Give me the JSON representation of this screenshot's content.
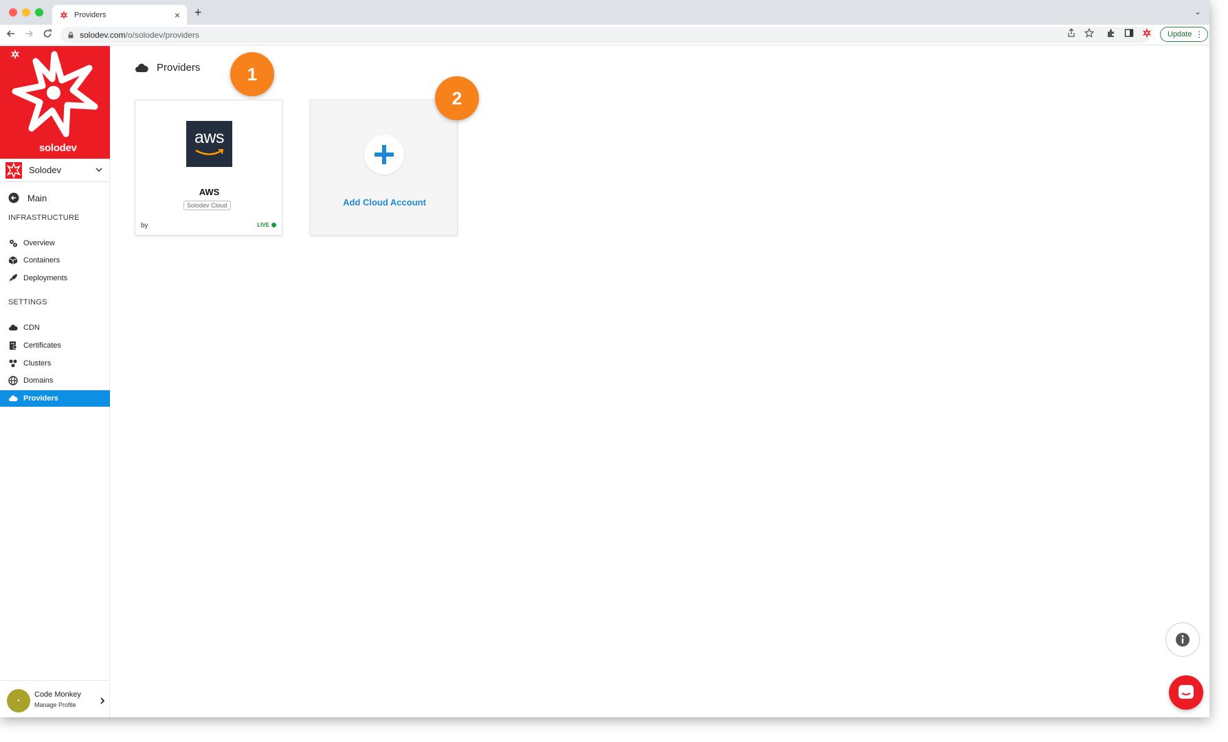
{
  "browser": {
    "tab_title": "Providers",
    "url_host": "solodev.com",
    "url_path": "/o/solodev/providers",
    "update_label": "Update"
  },
  "brand": {
    "name": "solodev",
    "accent": "#ec1c24"
  },
  "sidebar": {
    "org": "Solodev",
    "main_label": "Main",
    "infrastructure_heading": "INFRASTRUCTURE",
    "infrastructure": [
      {
        "label": "Overview",
        "icon": "gears-icon"
      },
      {
        "label": "Containers",
        "icon": "cube-icon"
      },
      {
        "label": "Deployments",
        "icon": "rocket-icon"
      }
    ],
    "settings_heading": "SETTINGS",
    "settings": [
      {
        "label": "CDN",
        "icon": "cloud-icon"
      },
      {
        "label": "Certificates",
        "icon": "certificate-icon"
      },
      {
        "label": "Clusters",
        "icon": "cluster-icon"
      },
      {
        "label": "Domains",
        "icon": "globe-icon"
      },
      {
        "label": "Providers",
        "icon": "cloud-icon",
        "active": true
      }
    ],
    "profile": {
      "name": "Code Monkey",
      "sub": "Manage Profile"
    }
  },
  "main": {
    "title": "Providers",
    "cards": [
      {
        "name": "AWS",
        "logo_text": "aws",
        "tag": "Solodev Cloud",
        "by": "by",
        "status": "LIVE"
      }
    ],
    "add_label": "Add Cloud Account",
    "markers": [
      "1",
      "2"
    ]
  }
}
